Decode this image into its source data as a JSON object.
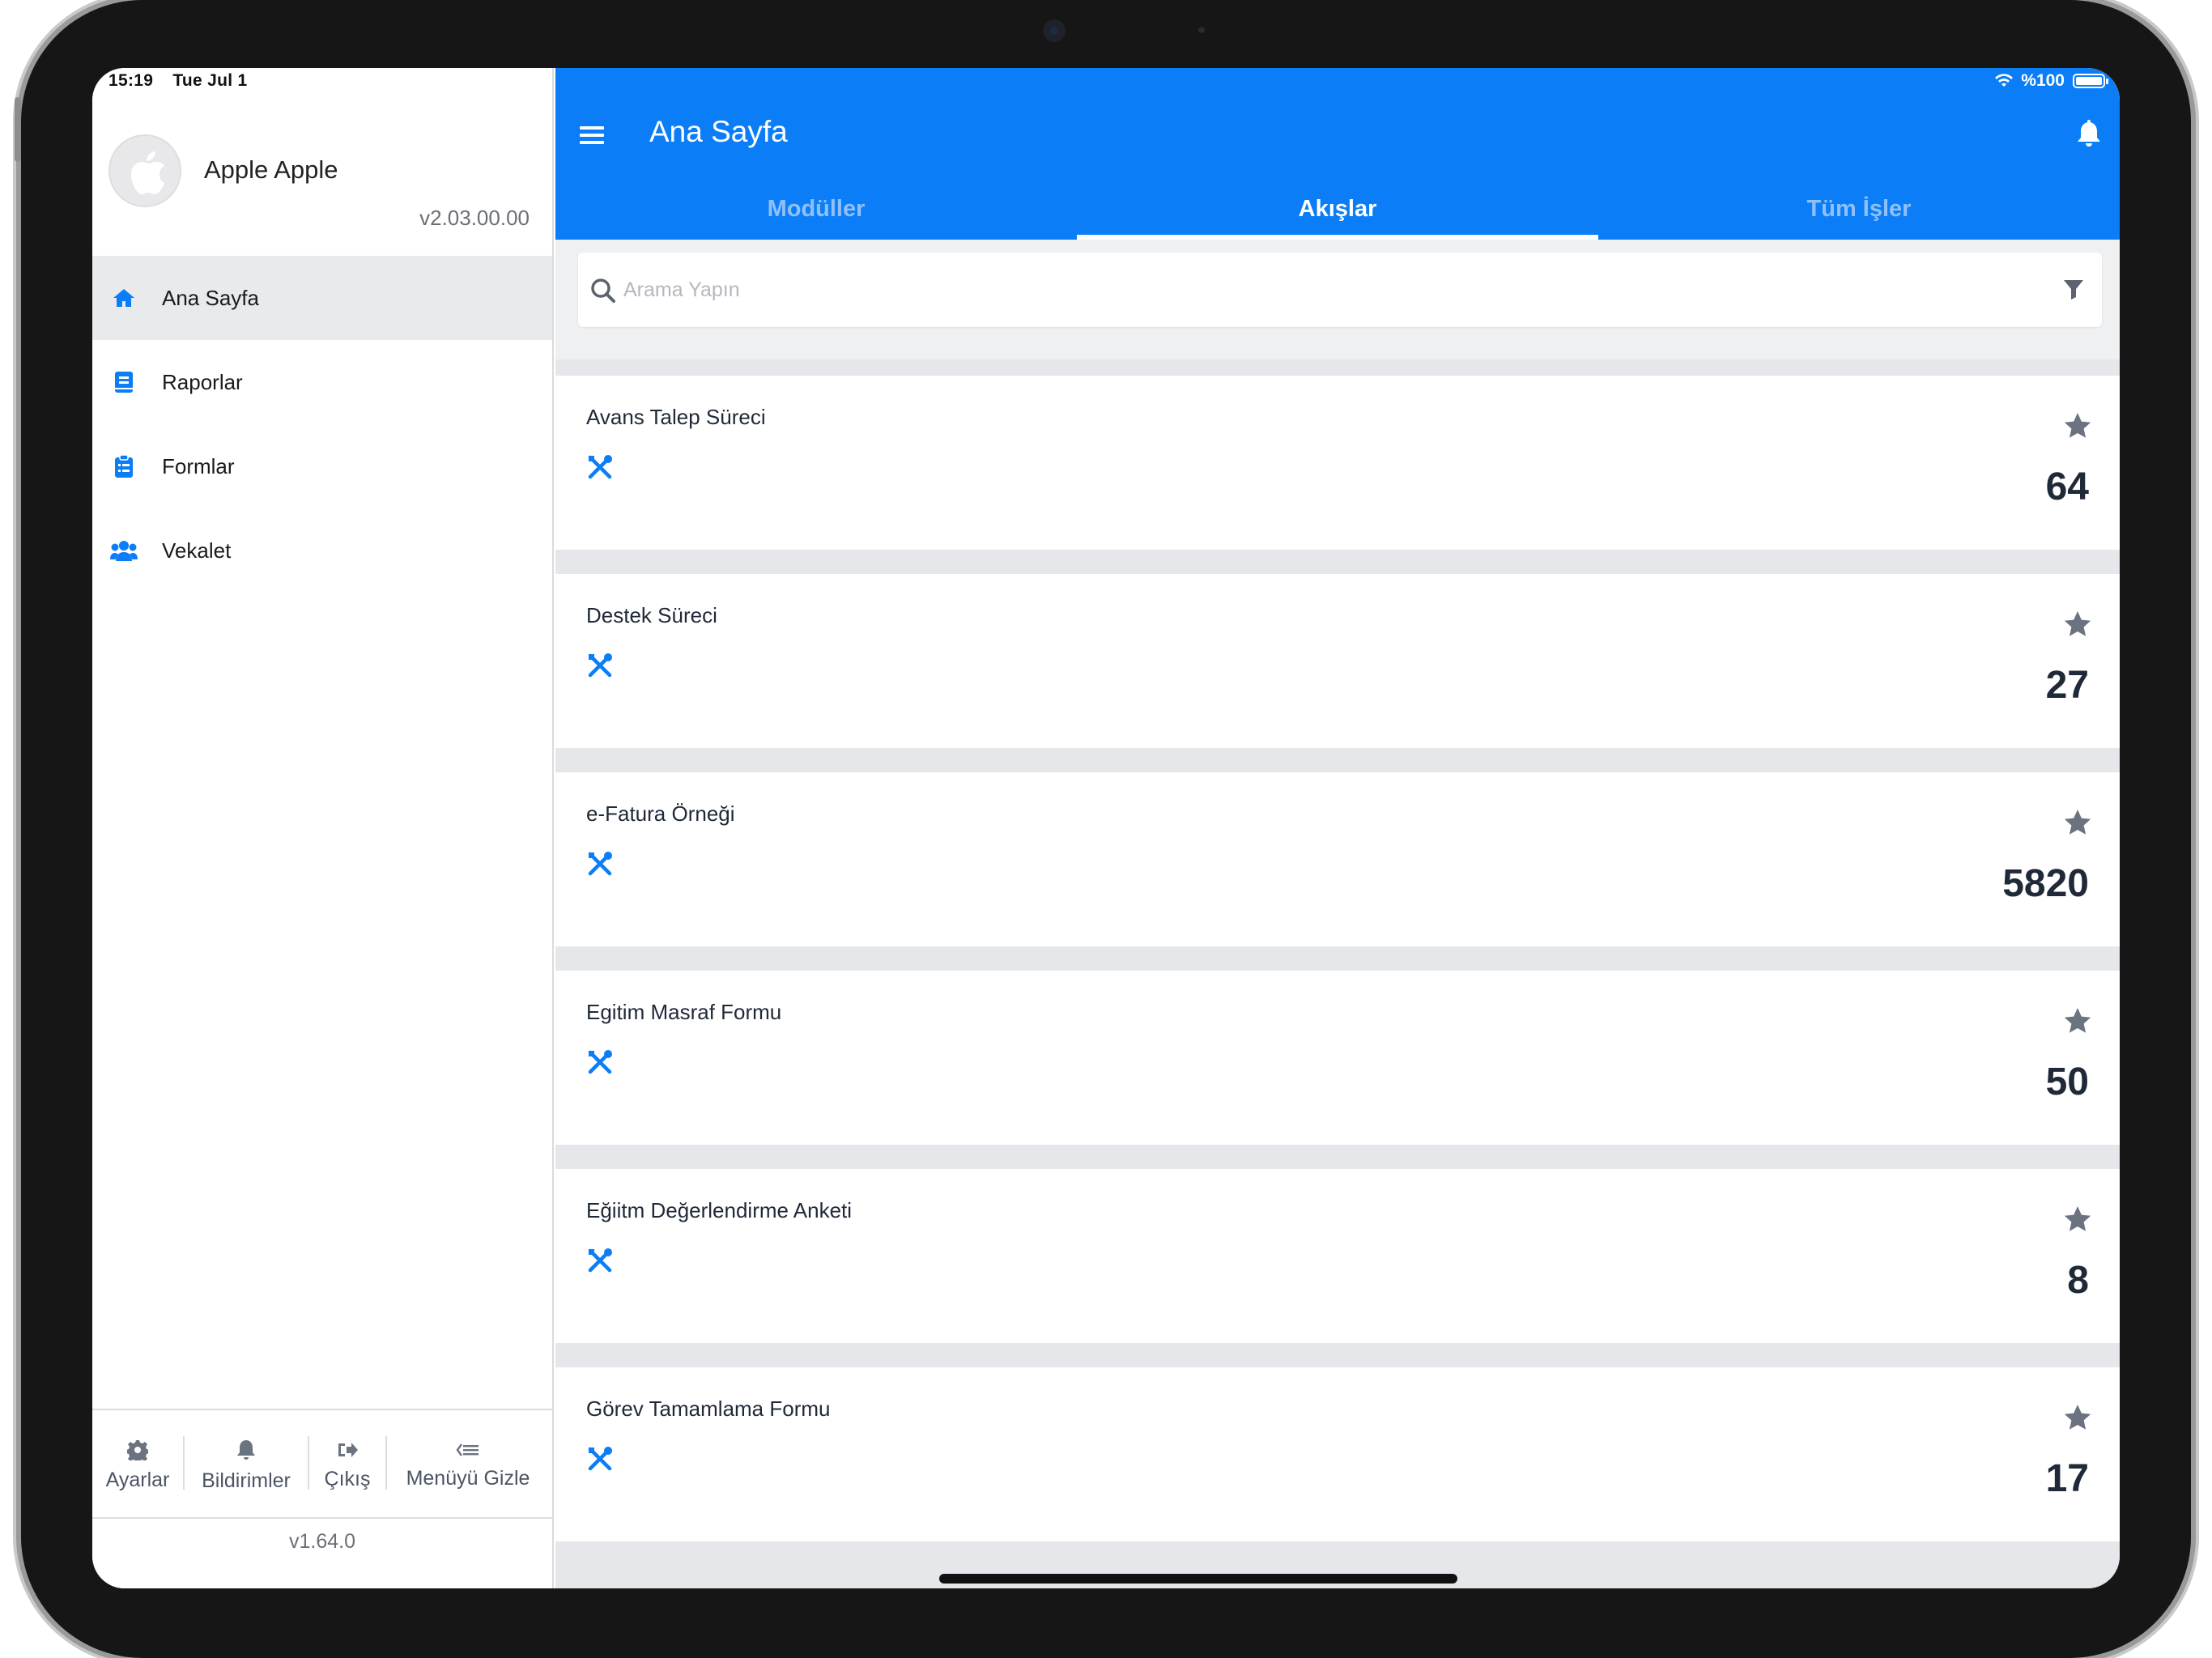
{
  "status_bar": {
    "time": "15:19",
    "date": "Tue Jul 1",
    "battery": "%100"
  },
  "sidebar": {
    "user_name": "Apple Apple",
    "app_version": "v2.03.00.00",
    "items": [
      {
        "label": "Ana Sayfa",
        "icon": "home-icon",
        "active": true
      },
      {
        "label": "Raporlar",
        "icon": "report-icon",
        "active": false
      },
      {
        "label": "Formlar",
        "icon": "form-icon",
        "active": false
      },
      {
        "label": "Vekalet",
        "icon": "users-icon",
        "active": false
      }
    ],
    "footer": [
      {
        "label": "Ayarlar",
        "icon": "gear-icon"
      },
      {
        "label": "Bildirimler",
        "icon": "bell-icon"
      },
      {
        "label": "Çıkış",
        "icon": "logout-icon"
      },
      {
        "label": "Menüyü Gizle",
        "icon": "collapse-menu-icon"
      }
    ],
    "build_version": "v1.64.0"
  },
  "header": {
    "title": "Ana Sayfa",
    "tabs": [
      {
        "label": "Modüller",
        "active": false
      },
      {
        "label": "Akışlar",
        "active": true
      },
      {
        "label": "Tüm İşler",
        "active": false
      }
    ]
  },
  "search": {
    "placeholder": "Arama Yapın",
    "value": ""
  },
  "flows": [
    {
      "title": "Avans Talep Süreci",
      "count": "64"
    },
    {
      "title": "Destek Süreci",
      "count": "27"
    },
    {
      "title": "e-Fatura Örneği",
      "count": "5820"
    },
    {
      "title": "Egitim Masraf Formu",
      "count": "50"
    },
    {
      "title": "Eğiitm Değerlendirme Anketi",
      "count": "8"
    },
    {
      "title": "Görev Tamamlama Formu",
      "count": "17"
    }
  ],
  "colors": {
    "accent": "#0b7ef7",
    "text_dark": "#1f2937",
    "star": "#6b7280"
  }
}
